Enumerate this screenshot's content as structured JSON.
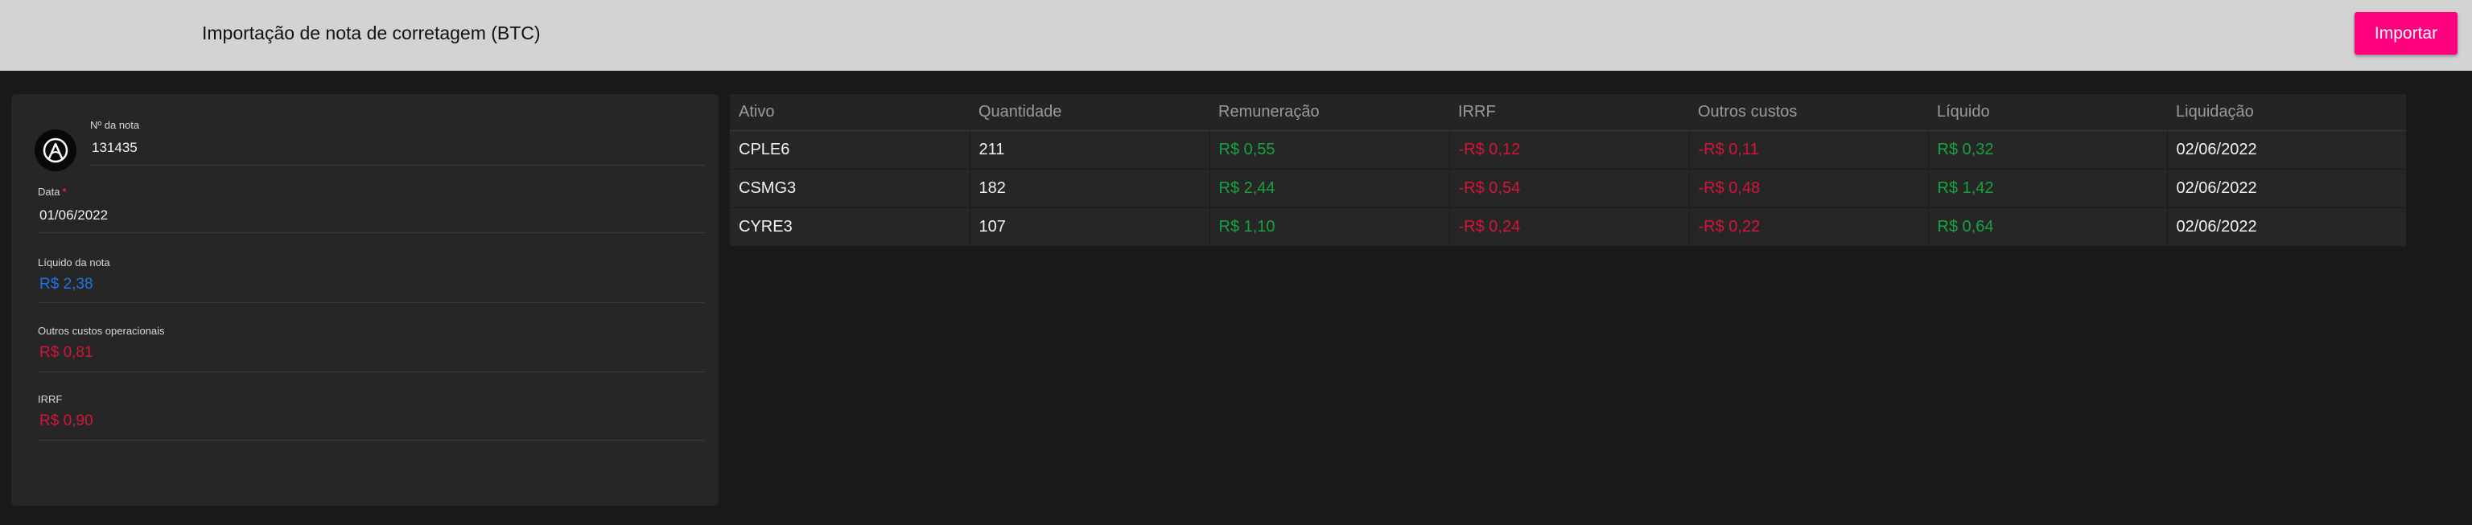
{
  "header": {
    "title": "Importação de nota de corretagem (BTC)",
    "import_label": "Importar"
  },
  "form": {
    "note_number": {
      "label": "Nº da nota",
      "value": "131435"
    },
    "date": {
      "label": "Data",
      "required_mark": "*",
      "value": "01/06/2022"
    },
    "net": {
      "label": "Líquido da nota",
      "value": "R$ 2,38"
    },
    "other_costs": {
      "label": "Outros custos operacionais",
      "value": "R$ 0,81"
    },
    "irrf": {
      "label": "IRRF",
      "value": "R$ 0,90"
    }
  },
  "table": {
    "columns": [
      "Ativo",
      "Quantidade",
      "Remuneração",
      "IRRF",
      "Outros custos",
      "Líquido",
      "Liquidação"
    ],
    "rows": [
      [
        "CPLE6",
        "211",
        "R$ 0,55",
        "-R$ 0,12",
        "-R$ 0,11",
        "R$ 0,32",
        "02/06/2022"
      ],
      [
        "CSMG3",
        "182",
        "R$ 2,44",
        "-R$ 0,54",
        "-R$ 0,48",
        "R$ 1,42",
        "02/06/2022"
      ],
      [
        "CYRE3",
        "107",
        "R$ 1,10",
        "-R$ 0,24",
        "-R$ 0,22",
        "R$ 0,64",
        "02/06/2022"
      ]
    ]
  },
  "colors": {
    "accent": "#ff007f",
    "positive": "#15a33d",
    "negative": "#d6143a",
    "info": "#1e73e8",
    "header_bg": "#d3d3d3",
    "page_bg": "#191919",
    "card_bg": "#262626"
  },
  "icons": {
    "avatar": "logo-icon"
  }
}
